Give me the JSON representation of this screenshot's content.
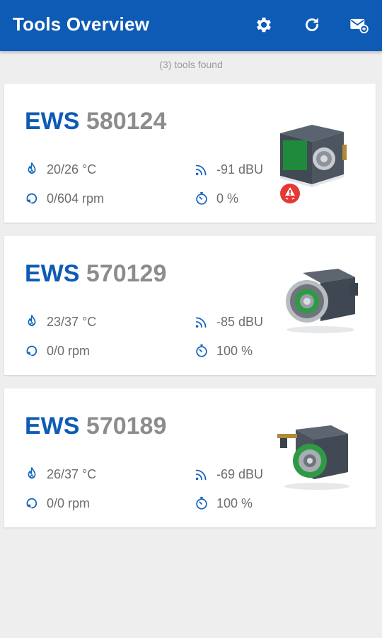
{
  "appbar": {
    "title": "Tools Overview",
    "settings_icon": "gear-icon",
    "refresh_icon": "refresh-icon",
    "mail_icon": "mail-icon",
    "color": "#0d5bb5"
  },
  "status": {
    "count_text": "(3) tools found"
  },
  "tools": [
    {
      "brand": "EWS",
      "id": "580124",
      "temperature": "20/26 °C",
      "rpm": "0/604 rpm",
      "signal": "-91 dBU",
      "battery": "0 %",
      "warning": true
    },
    {
      "brand": "EWS",
      "id": "570129",
      "temperature": "23/37 °C",
      "rpm": "0/0 rpm",
      "signal": "-85 dBU",
      "battery": "100 %",
      "warning": false
    },
    {
      "brand": "EWS",
      "id": "570189",
      "temperature": "26/37 °C",
      "rpm": "0/0 rpm",
      "signal": "-69 dBU",
      "battery": "100 %",
      "warning": false
    }
  ],
  "icons": {
    "temperature": "flame-icon",
    "rpm": "rotation-icon",
    "signal": "signal-icon",
    "battery": "timer-icon",
    "warning": "warning-icon"
  },
  "colors": {
    "brand": "#0d5bb5",
    "id": "#8c8c8c",
    "metric": "#6d6d6d",
    "warning": "#e53935"
  }
}
